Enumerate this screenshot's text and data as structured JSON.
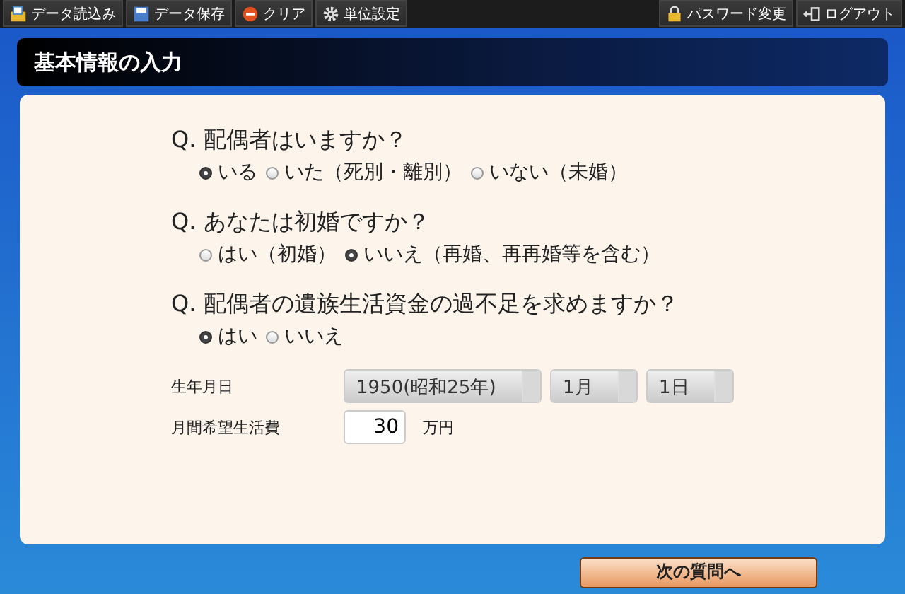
{
  "toolbar": {
    "left": [
      {
        "kind": "load",
        "label": "データ読込み"
      },
      {
        "kind": "save",
        "label": "データ保存"
      },
      {
        "kind": "clear",
        "label": "クリア"
      },
      {
        "kind": "settings",
        "label": "単位設定"
      }
    ],
    "right": [
      {
        "kind": "password",
        "label": "パスワード変更"
      },
      {
        "kind": "logout",
        "label": "ログアウト"
      }
    ]
  },
  "title": "基本情報の入力",
  "questions": [
    {
      "text": "Q. 配偶者はいますか？",
      "options": [
        {
          "label": "いる",
          "selected": true
        },
        {
          "label": "いた（死別・離別）",
          "selected": false
        },
        {
          "label": "いない（未婚）",
          "selected": false
        }
      ]
    },
    {
      "text": "Q. あなたは初婚ですか？",
      "options": [
        {
          "label": "はい（初婚）",
          "selected": false
        },
        {
          "label": "いいえ（再婚、再再婚等を含む）",
          "selected": true
        }
      ]
    },
    {
      "text": "Q. 配偶者の遺族生活資金の過不足を求めますか？",
      "options": [
        {
          "label": "はい",
          "selected": true
        },
        {
          "label": "いいえ",
          "selected": false
        }
      ]
    }
  ],
  "birth": {
    "label": "生年月日",
    "year": "1950(昭和25年)",
    "month": "1月",
    "day": "1日"
  },
  "living_cost": {
    "label": "月間希望生活費",
    "value": "30",
    "unit": "万円"
  },
  "next_button": "次の質問へ"
}
